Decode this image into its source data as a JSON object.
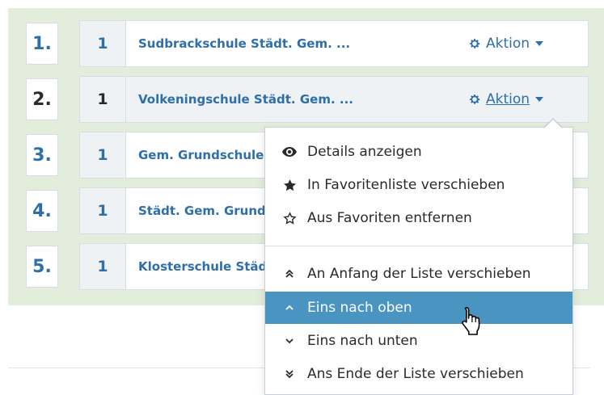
{
  "rows": [
    {
      "rank": "1.",
      "count": "1",
      "name": "Sudbrackschule Städt. Gem. ..."
    },
    {
      "rank": "2.",
      "count": "1",
      "name": "Volkeningschule Städt. Gem. ..."
    },
    {
      "rank": "3.",
      "count": "1",
      "name": "Gem. Grundschule"
    },
    {
      "rank": "4.",
      "count": "1",
      "name": "Städt. Gem. Grundschule"
    },
    {
      "rank": "5.",
      "count": "1",
      "name": "Klosterschule Städt."
    }
  ],
  "action_label": "Aktion",
  "menu": {
    "details": "Details anzeigen",
    "fav_move": "In Favoritenliste verschieben",
    "fav_remove": "Aus Favoriten entfernen",
    "to_top": "An Anfang der Liste verschieben",
    "up": "Eins nach oben",
    "down": "Eins nach unten",
    "to_bottom": "Ans Ende der Liste verschieben"
  },
  "colors": {
    "accent": "#2f6fa8",
    "highlight": "#4a94c2",
    "panel_bg": "#e3eddc"
  },
  "icons": {
    "details": "eye-icon",
    "fav_move": "star-filled-icon",
    "fav_remove": "star-outline-icon",
    "to_top": "double-chevron-up-icon",
    "up": "chevron-up-icon",
    "down": "chevron-down-icon",
    "to_bottom": "double-chevron-down-icon",
    "action": "gear-icon"
  }
}
